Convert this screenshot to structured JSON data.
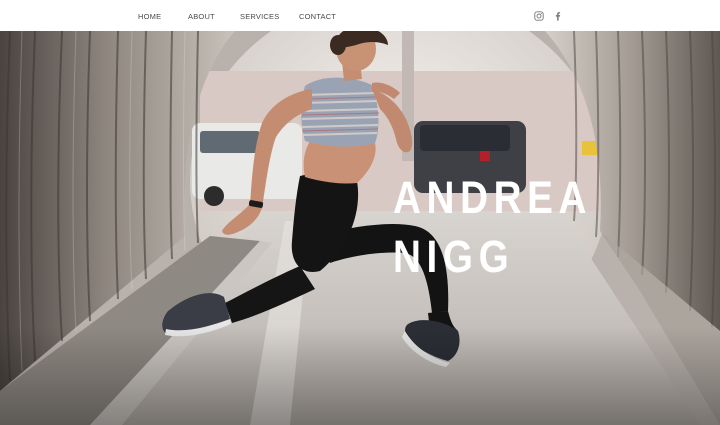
{
  "nav": {
    "items": [
      {
        "label": "HOME"
      },
      {
        "label": "ABOUT"
      },
      {
        "label": "SERVICES"
      },
      {
        "label": "CONTACT"
      }
    ]
  },
  "social": {
    "icons": [
      "instagram-icon",
      "facebook-icon"
    ],
    "color": "#777777"
  },
  "hero": {
    "title_line1": "ANDREA",
    "title_line2": "NIGG",
    "title_color": "#ffffff"
  },
  "colors": {
    "nav_text": "#4a4a4a",
    "header_bg": "#ffffff"
  }
}
